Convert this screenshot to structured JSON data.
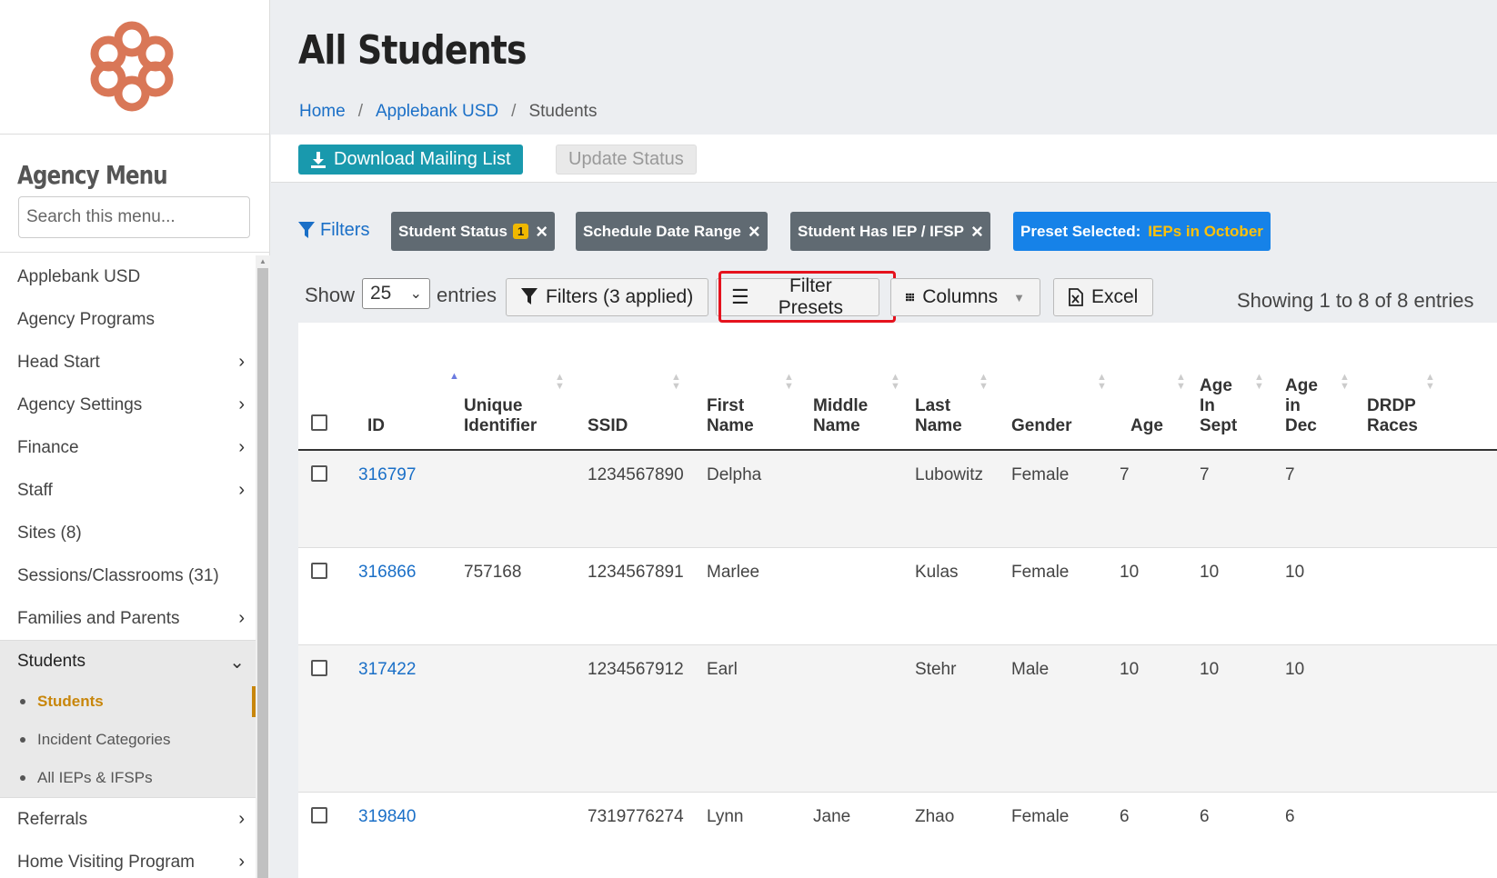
{
  "sidebar": {
    "menu_title": "Agency Menu",
    "search_placeholder": "Search this menu...",
    "items": [
      {
        "label": "Applebank USD",
        "has_submenu": false
      },
      {
        "label": "Agency Programs",
        "has_submenu": false
      },
      {
        "label": "Head Start",
        "has_submenu": true
      },
      {
        "label": "Agency Settings",
        "has_submenu": true
      },
      {
        "label": "Finance",
        "has_submenu": true
      },
      {
        "label": "Staff",
        "has_submenu": true
      },
      {
        "label": "Sites (8)",
        "has_submenu": false
      },
      {
        "label": "Sessions/Classrooms (31)",
        "has_submenu": false
      },
      {
        "label": "Families and Parents",
        "has_submenu": true
      }
    ],
    "active_group": {
      "label": "Students",
      "subitems": [
        "Students",
        "Incident Categories",
        "All IEPs & IFSPs"
      ],
      "current": "Students"
    },
    "after_items": [
      {
        "label": "Referrals",
        "has_submenu": true
      },
      {
        "label": "Home Visiting Program",
        "has_submenu": true
      }
    ]
  },
  "header": {
    "title": "All Students",
    "breadcrumb": [
      "Home",
      "Applebank USD",
      "Students"
    ]
  },
  "toolbar": {
    "download_label": "Download Mailing List",
    "update_label": "Update Status"
  },
  "filters": {
    "label": "Filters",
    "chips": [
      {
        "label": "Student Status",
        "count": "1"
      },
      {
        "label": "Schedule Date Range"
      },
      {
        "label": "Student Has IEP / IFSP"
      }
    ],
    "preset": {
      "prefix": "Preset Selected:",
      "value": "IEPs in October"
    }
  },
  "controls": {
    "show_label": "Show",
    "entries_value": "25",
    "entries_label": "entries",
    "filters_applied": "Filters (3 applied)",
    "filter_presets": "Filter Presets",
    "columns": "Columns",
    "excel": "Excel",
    "showing": "Showing 1 to 8 of 8 entries"
  },
  "table": {
    "columns": [
      "ID",
      "Unique Identifier",
      "SSID",
      "First Name",
      "Middle Name",
      "Last Name",
      "Gender",
      "Age",
      "Age In Sept",
      "Age in Dec",
      "DRDP Races"
    ],
    "rows": [
      {
        "id": "316797",
        "unique": "",
        "ssid": "1234567890",
        "first": "Delpha",
        "middle": "",
        "last": "Lubowitz",
        "gender": "Female",
        "age": "7",
        "age_sept": "7",
        "age_dec": "7",
        "races": ""
      },
      {
        "id": "316866",
        "unique": "757168",
        "ssid": "1234567891",
        "first": "Marlee",
        "middle": "",
        "last": "Kulas",
        "gender": "Female",
        "age": "10",
        "age_sept": "10",
        "age_dec": "10",
        "races": ""
      },
      {
        "id": "317422",
        "unique": "",
        "ssid": "1234567912",
        "first": "Earl",
        "middle": "",
        "last": "Stehr",
        "gender": "Male",
        "age": "10",
        "age_sept": "10",
        "age_dec": "10",
        "races": ""
      },
      {
        "id": "319840",
        "unique": "",
        "ssid": "7319776274",
        "first": "Lynn",
        "middle": "Jane",
        "last": "Zhao",
        "gender": "Female",
        "age": "6",
        "age_sept": "6",
        "age_dec": "6",
        "races": ""
      }
    ]
  },
  "colors": {
    "brand": "#d97757",
    "link": "#1a6fc7",
    "accent_teal": "#1999ad",
    "chip_gray": "#606a72",
    "preset_blue": "#1682e8",
    "highlight_red": "#e5121d",
    "current_item": "#c8860b"
  }
}
